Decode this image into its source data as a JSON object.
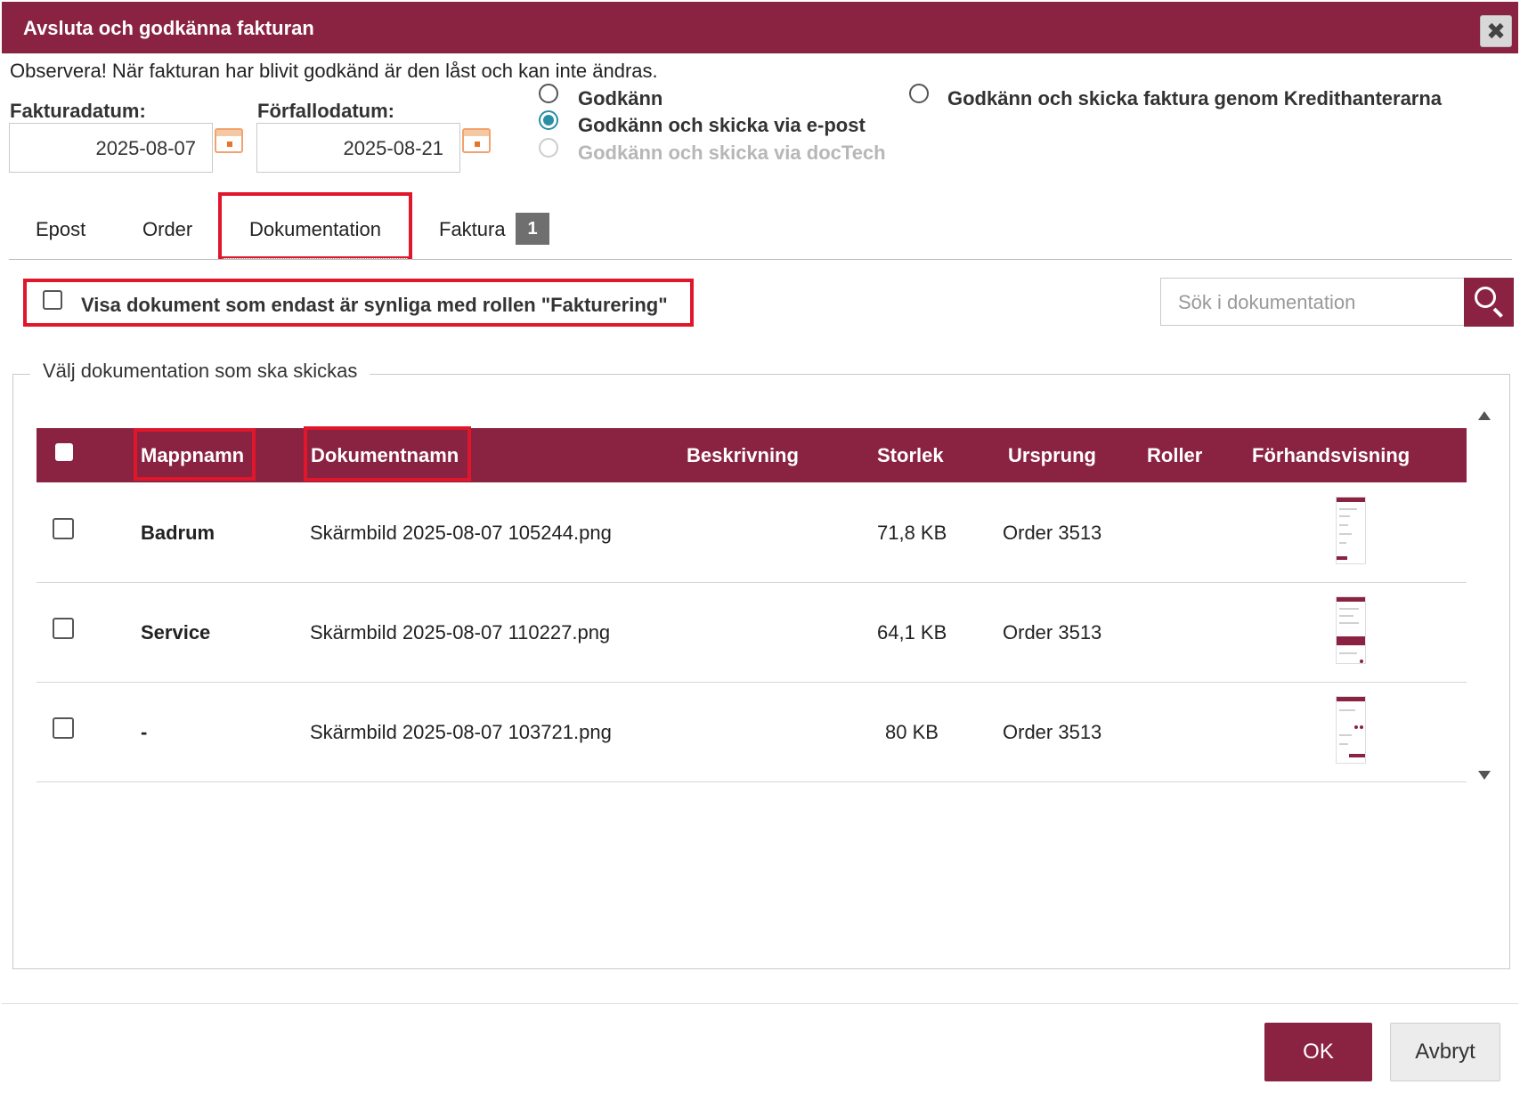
{
  "dialog": {
    "title": "Avsluta och godkänna fakturan",
    "close_icon": "close-icon",
    "notice": "Observera! När fakturan har blivit godkänd är den låst och kan inte ändras."
  },
  "dates": {
    "invoice_date_label": "Fakturadatum:",
    "invoice_date_value": "2025-08-07",
    "due_date_label": "Förfallodatum:",
    "due_date_value": "2025-08-21",
    "calendar_icon": "calendar-icon"
  },
  "approval_options": [
    {
      "label": "Godkänn",
      "checked": false,
      "disabled": false
    },
    {
      "label": "Godkänn och skicka via e-post",
      "checked": true,
      "disabled": false
    },
    {
      "label": "Godkänn och skicka via docTech",
      "checked": false,
      "disabled": true
    },
    {
      "label": "Godkänn och skicka faktura genom Kredithanterarna",
      "checked": false,
      "disabled": false
    }
  ],
  "tabs": [
    {
      "label": "Epost"
    },
    {
      "label": "Order"
    },
    {
      "label": "Dokumentation",
      "active": true
    },
    {
      "label": "Faktura",
      "badge": "1"
    }
  ],
  "filter": {
    "label": "Visa dokument som endast är synliga med rollen \"Fakturering\"",
    "checked": false
  },
  "search": {
    "placeholder": "Sök i dokumentation",
    "icon": "search-icon"
  },
  "documents": {
    "legend": "Välj dokumentation som ska skickas",
    "columns": [
      "Mappnamn",
      "Dokumentnamn",
      "Beskrivning",
      "Storlek",
      "Ursprung",
      "Roller",
      "Förhandsvisning"
    ],
    "rows": [
      {
        "folder": "Badrum",
        "name": "Skärmbild 2025-08-07 105244.png",
        "description": "",
        "size": "71,8 KB",
        "origin": "Order 3513",
        "roles": ""
      },
      {
        "folder": "Service",
        "name": "Skärmbild 2025-08-07 110227.png",
        "description": "",
        "size": "64,1 KB",
        "origin": "Order 3513",
        "roles": ""
      },
      {
        "folder": "-",
        "name": "Skärmbild 2025-08-07 103721.png",
        "description": "",
        "size": "80 KB",
        "origin": "Order 3513",
        "roles": ""
      }
    ]
  },
  "footer": {
    "ok_label": "OK",
    "cancel_label": "Avbryt"
  },
  "colors": {
    "brand": "#8a2342",
    "highlight": "#e0162b",
    "radio_checked": "#2a8fa3"
  }
}
